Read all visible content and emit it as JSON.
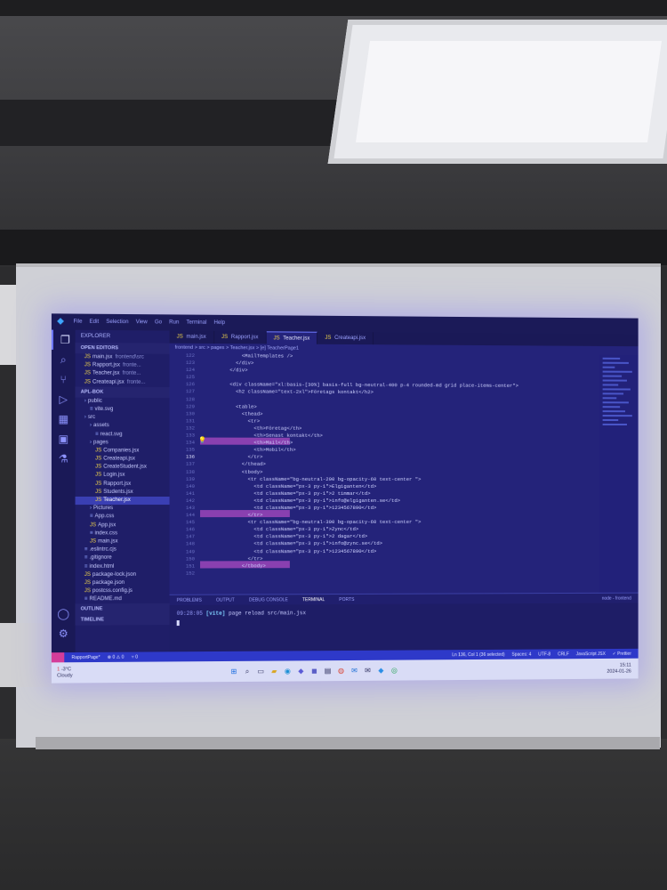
{
  "window": {
    "app_icon": "vscode-icon",
    "menu": [
      "File",
      "Edit",
      "Selection",
      "View",
      "Go",
      "Run",
      "Terminal",
      "Help"
    ]
  },
  "sidebar": {
    "header": "EXPLORER",
    "open_editors_header": "OPEN EDITORS",
    "open_editors": [
      {
        "name": "main.jsx",
        "path": "frontend\\src"
      },
      {
        "name": "Rapport.jsx",
        "path": "fronte..."
      },
      {
        "name": "Teacher.jsx",
        "path": "fronte..."
      },
      {
        "name": "Createapi.jsx",
        "path": "fronte..."
      }
    ],
    "project_header": "APL-BOK",
    "tree": [
      {
        "name": "public",
        "type": "folder",
        "indent": 1
      },
      {
        "name": "vite.svg",
        "type": "file",
        "indent": 2
      },
      {
        "name": "src",
        "type": "folder",
        "indent": 1
      },
      {
        "name": "assets",
        "type": "folder",
        "indent": 2
      },
      {
        "name": "react.svg",
        "type": "file",
        "indent": 3
      },
      {
        "name": "pages",
        "type": "folder",
        "indent": 2
      },
      {
        "name": "Companies.jsx",
        "type": "js",
        "indent": 3
      },
      {
        "name": "Createapi.jsx",
        "type": "js",
        "indent": 3
      },
      {
        "name": "CreateStudent.jsx",
        "type": "js",
        "indent": 3
      },
      {
        "name": "Login.jsx",
        "type": "js",
        "indent": 3
      },
      {
        "name": "Rapport.jsx",
        "type": "js",
        "indent": 3
      },
      {
        "name": "Students.jsx",
        "type": "js",
        "indent": 3
      },
      {
        "name": "Teacher.jsx",
        "type": "js",
        "indent": 3,
        "selected": true
      },
      {
        "name": "Pictures",
        "type": "folder",
        "indent": 2
      },
      {
        "name": "App.css",
        "type": "file",
        "indent": 2
      },
      {
        "name": "App.jsx",
        "type": "js",
        "indent": 2
      },
      {
        "name": "index.css",
        "type": "file",
        "indent": 2
      },
      {
        "name": "main.jsx",
        "type": "js",
        "indent": 2
      },
      {
        "name": ".eslintrc.cjs",
        "type": "file",
        "indent": 1
      },
      {
        "name": ".gitignore",
        "type": "file",
        "indent": 1
      },
      {
        "name": "index.html",
        "type": "file",
        "indent": 1
      },
      {
        "name": "package-lock.json",
        "type": "js",
        "indent": 1
      },
      {
        "name": "package.json",
        "type": "js",
        "indent": 1
      },
      {
        "name": "postcss.config.js",
        "type": "js",
        "indent": 1
      },
      {
        "name": "README.md",
        "type": "file",
        "indent": 1
      }
    ],
    "outline_header": "OUTLINE",
    "timeline_header": "TIMELINE"
  },
  "tabs": [
    {
      "label": "main.jsx",
      "active": false
    },
    {
      "label": "Rapport.jsx",
      "active": false
    },
    {
      "label": "Teacher.jsx",
      "active": true
    },
    {
      "label": "Createapi.jsx",
      "active": false
    }
  ],
  "breadcrumb": "frontend > src > pages > Teacher.jsx > [e] TeacherPage1",
  "editor": {
    "line_numbers": [
      "122",
      "123",
      "124",
      "125",
      "126",
      "127",
      "128",
      "129",
      "130",
      "131",
      "132",
      "133",
      "134",
      "135",
      "136",
      "137",
      "138",
      "139",
      "140",
      "141",
      "142",
      "143",
      "144",
      "145",
      "146",
      "147",
      "148",
      "149",
      "150",
      "151",
      "152"
    ],
    "current_line": "136",
    "lines": [
      "            <MailTemplates />",
      "          </div>",
      "        </div>",
      "",
      "        <div className=\"xl:basis-[30%] basis-full bg-neutral-400 p-4 rounded-md grid place-items-center\">",
      "          <h2 className=\"text-2xl\">Företags kontakt</h2>",
      "",
      "          <table>",
      "            <thead>",
      "              <tr>",
      "                <th>Företag</th>",
      "                <th>Senast kontakt</th>",
      "                <th>Mail</th>",
      "                <th>Mobil</th>",
      "              </tr>",
      "            </thead>",
      "            <tbody>",
      "              <tr className=\"bg-neutral-200 bg-opacity-60 text-center \">",
      "                <td className=\"px-3 py-1\">Elgiganten</td>",
      "                <td className=\"px-3 py-1\">2 timmar</td>",
      "                <td className=\"px-3 py-1\">info@elgiganten.se</td>",
      "                <td className=\"px-3 py-1\">1234567890</td>",
      "              </tr>",
      "              <tr className=\"bg-neutral-300 bg-opacity-60 text-center \">",
      "                <td className=\"px-3 py-1\">Zync</td>",
      "                <td className=\"px-3 py-1\">2 dagar</td>",
      "                <td className=\"px-3 py-1\">info@zync.se</td>",
      "                <td className=\"px-3 py-1\">1234567890</td>",
      "              </tr>",
      "            </tbody>",
      ""
    ]
  },
  "panel": {
    "tabs": [
      "PROBLEMS",
      "OUTPUT",
      "DEBUG CONSOLE",
      "TERMINAL",
      "PORTS"
    ],
    "active_tab": "TERMINAL",
    "terminal_name": "node - frontend",
    "terminal_time": "09:28:05",
    "terminal_tag": "[vite]",
    "terminal_msg": "page reload src/main.jsx"
  },
  "statusbar": {
    "branch": "RapportPage*",
    "problems": "⊗ 0 ⚠ 0",
    "ports": "⑂ 0",
    "position": "Ln 136, Col 1 (36 selected)",
    "spaces": "Spaces: 4",
    "encoding": "UTF-8",
    "eol": "CRLF",
    "language": "JavaScript JSX",
    "prettier": "✓ Prettier"
  },
  "taskbar": {
    "badge": "1",
    "weather": "-3°C",
    "weather_desc": "Cloudy",
    "time": "15:11",
    "date": "2024-01-26"
  }
}
